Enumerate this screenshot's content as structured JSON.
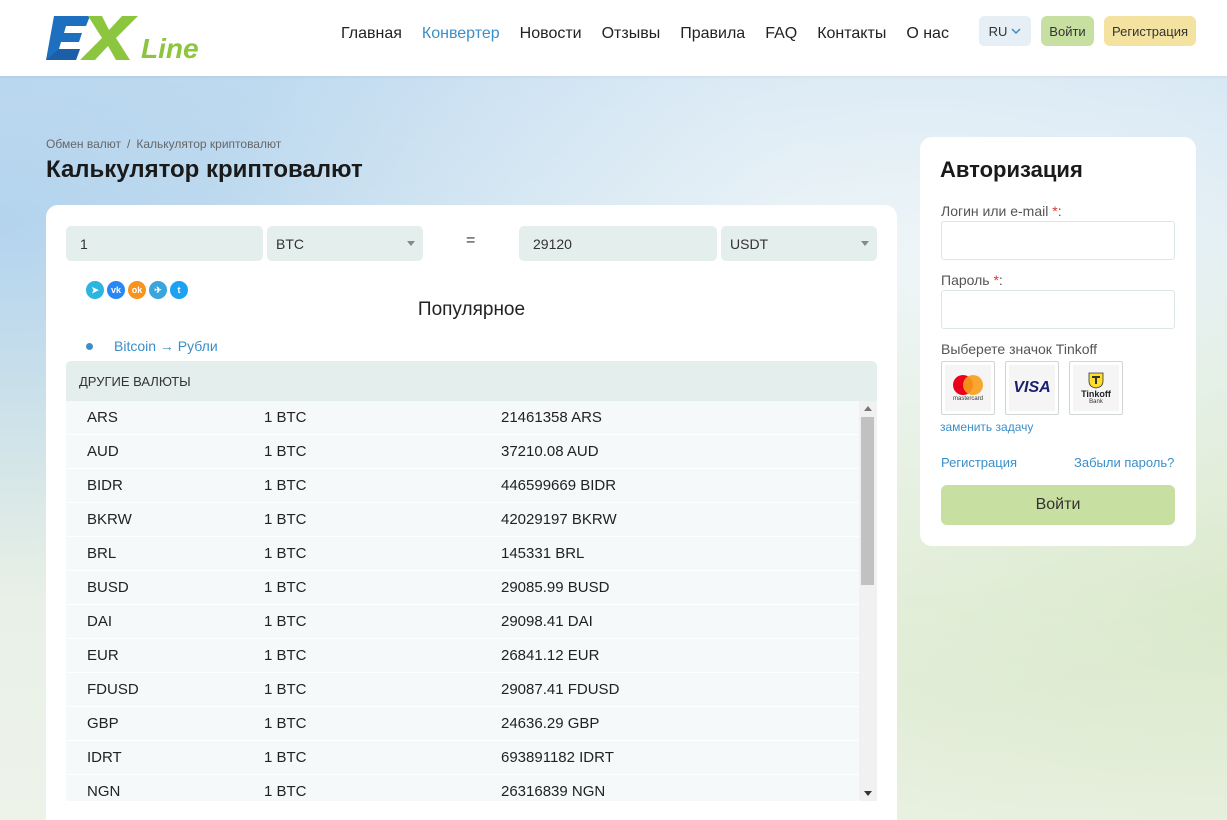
{
  "header": {
    "logo_ex": "EX",
    "logo_line": "Line",
    "nav": [
      {
        "label": "Главная"
      },
      {
        "label": "Конвертер",
        "active": true
      },
      {
        "label": "Новости"
      },
      {
        "label": "Отзывы"
      },
      {
        "label": "Правила"
      },
      {
        "label": "FAQ"
      },
      {
        "label": "Контакты"
      },
      {
        "label": "О нас"
      }
    ],
    "lang": "RU",
    "login_label": "Войти",
    "register_label": "Регистрация"
  },
  "breadcrumb": {
    "home": "Обмен валют",
    "separator": "/",
    "current": "Калькулятор криптовалют"
  },
  "page_title": "Калькулятор криптовалют",
  "converter": {
    "amount_from": "1",
    "currency_from": "BTC",
    "equals": "=",
    "amount_to": "29120",
    "currency_to": "USDT"
  },
  "social_icons": [
    "share-icon",
    "vk-icon",
    "odnoklassniki-icon",
    "telegram-icon",
    "twitter-icon"
  ],
  "popular": {
    "title": "Популярное",
    "link": "Bitcoin → Рубли"
  },
  "table": {
    "header": "ДРУГИЕ ВАЛЮТЫ",
    "rows": [
      {
        "currency": "ARS",
        "base": "1 BTC",
        "value": "21461358 ARS"
      },
      {
        "currency": "AUD",
        "base": "1 BTC",
        "value": "37210.08 AUD"
      },
      {
        "currency": "BIDR",
        "base": "1 BTC",
        "value": "446599669 BIDR"
      },
      {
        "currency": "BKRW",
        "base": "1 BTC",
        "value": "42029197 BKRW"
      },
      {
        "currency": "BRL",
        "base": "1 BTC",
        "value": "145331 BRL"
      },
      {
        "currency": "BUSD",
        "base": "1 BTC",
        "value": "29085.99 BUSD"
      },
      {
        "currency": "DAI",
        "base": "1 BTC",
        "value": "29098.41 DAI"
      },
      {
        "currency": "EUR",
        "base": "1 BTC",
        "value": "26841.12 EUR"
      },
      {
        "currency": "FDUSD",
        "base": "1 BTC",
        "value": "29087.41 FDUSD"
      },
      {
        "currency": "GBP",
        "base": "1 BTC",
        "value": "24636.29 GBP"
      },
      {
        "currency": "IDRT",
        "base": "1 BTC",
        "value": "693891182 IDRT"
      },
      {
        "currency": "NGN",
        "base": "1 BTC",
        "value": "26316839 NGN"
      }
    ]
  },
  "auth": {
    "title": "Авторизация",
    "login_label": "Логин или e-mail",
    "password_label": "Пароль",
    "required_mark": "*",
    "colon": ":",
    "captcha_prompt": "Выберете значок Tinkoff",
    "captcha_options": [
      {
        "name": "mastercard",
        "text": "mastercard"
      },
      {
        "name": "visa",
        "text": "VISA"
      },
      {
        "name": "tinkoff",
        "text": "Tinkoff",
        "subtext": "Bank"
      }
    ],
    "change_task": "заменить задачу",
    "register_link": "Регистрация",
    "forgot_link": "Забыли пароль?",
    "submit_label": "Войти"
  },
  "colors": {
    "accent_blue": "#3a8fc9",
    "login_green": "#c8dfa2",
    "register_yellow": "#f4e2a0",
    "logo_blue": "#1e6fc0",
    "logo_green": "#8cc63f"
  }
}
